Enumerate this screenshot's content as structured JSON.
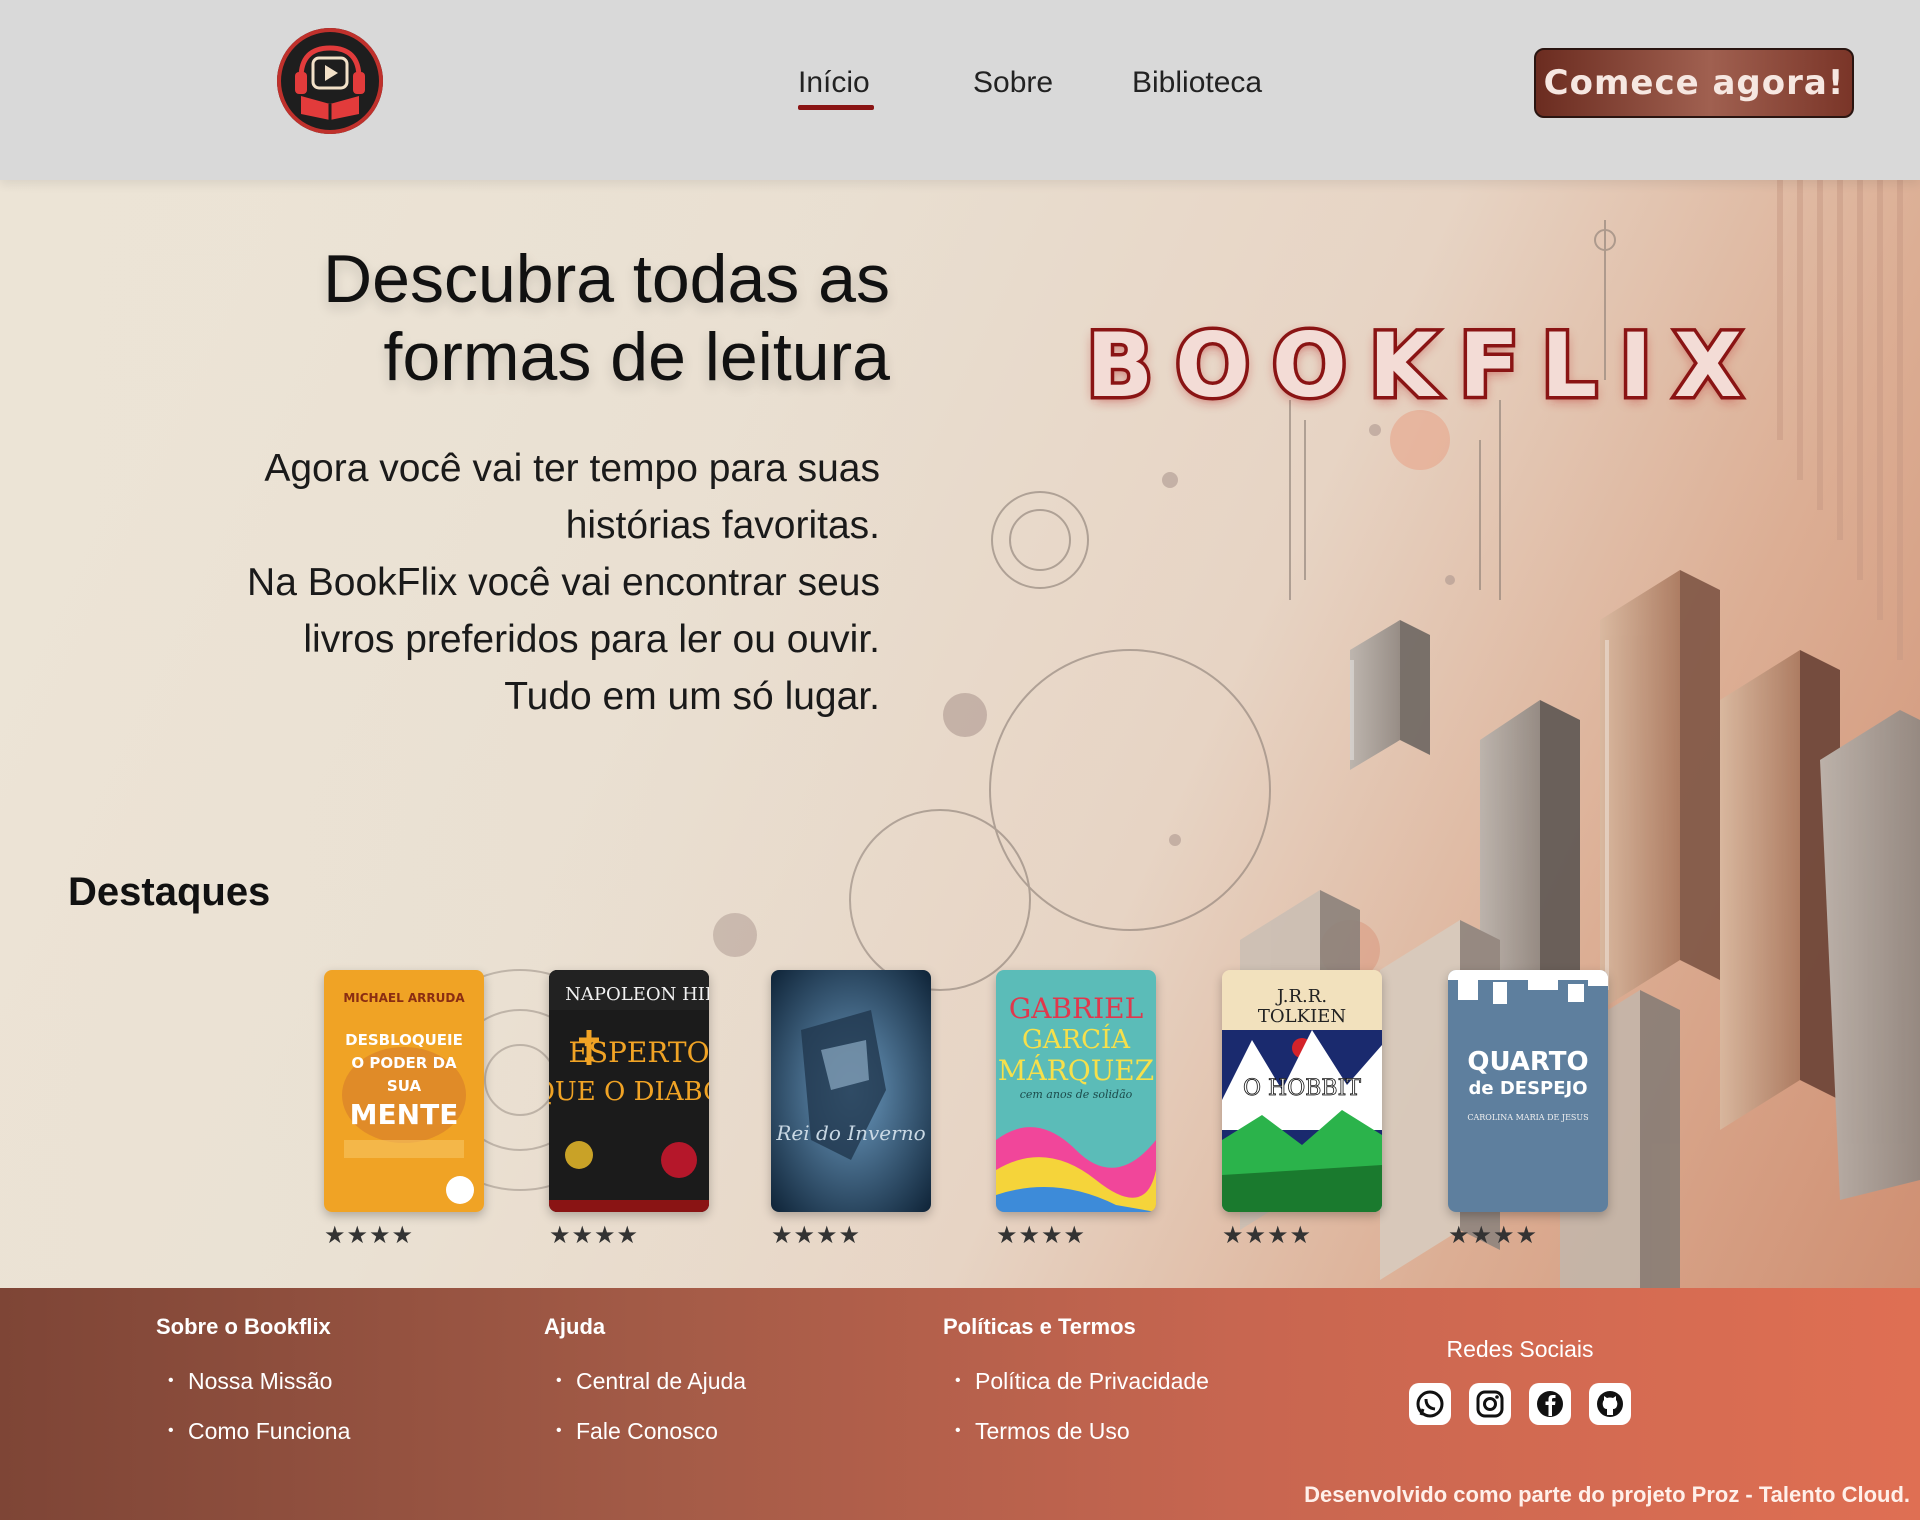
{
  "header": {
    "logo_alt": "Bookflix",
    "nav": {
      "home": "Início",
      "about": "Sobre",
      "library": "Biblioteca"
    },
    "cta": "Comece agora!"
  },
  "hero": {
    "title_line1": "Descubra todas as",
    "title_line2": "formas de leitura",
    "text_lines": [
      "Agora você vai ter tempo para suas",
      "histórias favoritas.",
      "Na BookFlix você vai encontrar seus",
      "livros preferidos para ler ou ouvir.",
      "Tudo em um só lugar."
    ],
    "brand": "BOOKFLIX"
  },
  "highlights": {
    "title": "Destaques",
    "books": [
      {
        "author": "MICHAEL ARRUDA",
        "title": "DESBLOQUEIE O PODER DA SUA MENTE",
        "rating": 4,
        "stars": "★★★★"
      },
      {
        "author": "NAPOLEON HILL",
        "title": "MAIS ESPERTO QUE O DIABO",
        "rating": 4,
        "stars": "★★★★"
      },
      {
        "author": "",
        "title": "Rei do Inverno",
        "rating": 4,
        "stars": "★★★★"
      },
      {
        "author": "GABRIEL GARCÍA MÁRQUEZ",
        "title": "cem anos de solidão",
        "rating": 4,
        "stars": "★★★★"
      },
      {
        "author": "J.R.R. TOLKIEN",
        "title": "O HOBBIT",
        "rating": 4,
        "stars": "★★★★"
      },
      {
        "author": "CAROLINA MARIA DE JESUS",
        "title": "QUARTO de DESPEJO",
        "rating": 4,
        "stars": "★★★★"
      }
    ]
  },
  "footer": {
    "about": {
      "title": "Sobre o Bookflix",
      "items": [
        "Nossa Missão",
        "Como Funciona"
      ]
    },
    "help": {
      "title": "Ajuda",
      "items": [
        "Central de Ajuda",
        "Fale Conosco"
      ]
    },
    "policies": {
      "title": "Políticas e Termos",
      "items": [
        "Política de Privacidade",
        "Termos de Uso"
      ]
    },
    "social": {
      "title": "Redes Sociais",
      "icons": [
        "whatsapp-icon",
        "instagram-icon",
        "facebook-icon",
        "github-icon"
      ]
    },
    "credit": "Desenvolvido como parte do projeto Proz - Talento Cloud."
  },
  "colors": {
    "accent": "#8a1414",
    "brand_red": "#a51d1d",
    "footer_start": "#7e4536",
    "footer_end": "#df6f53",
    "header_bg": "#d9d9d9"
  }
}
